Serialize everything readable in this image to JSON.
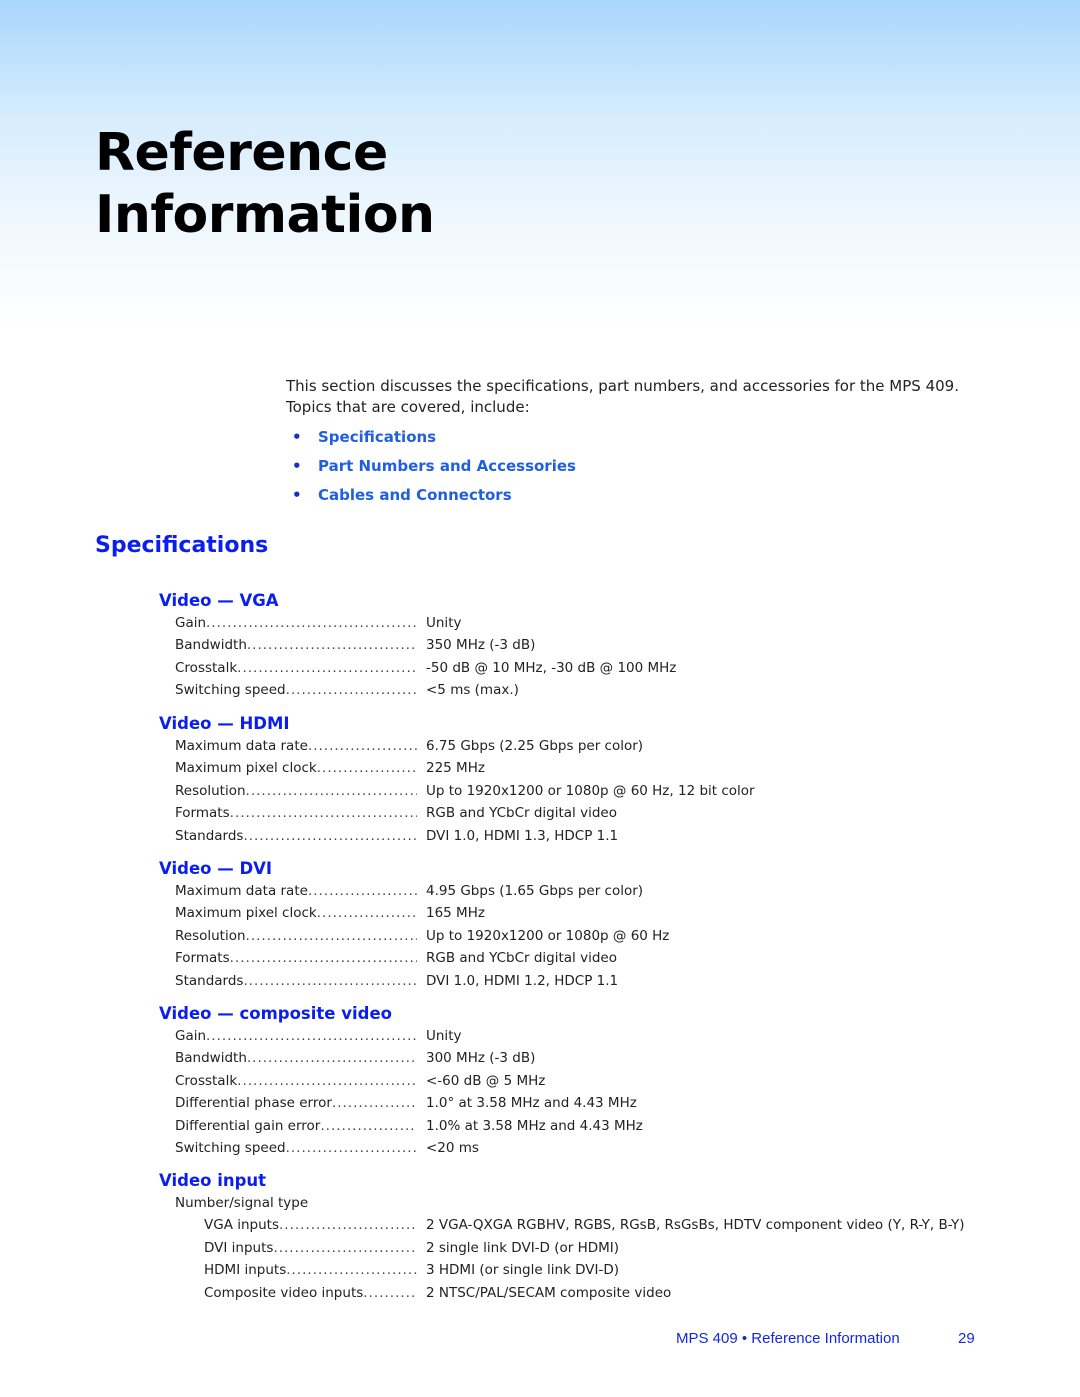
{
  "page_title_line1": "Reference",
  "page_title_line2": "Information",
  "intro": {
    "line1": "This section discusses the specifications, part numbers, and accessories for the MPS 409.",
    "line2": "Topics that are covered, include:"
  },
  "topics": [
    {
      "bullet": "•",
      "label": "Specifications"
    },
    {
      "bullet": "•",
      "label": "Part Numbers and Accessories"
    },
    {
      "bullet": "•",
      "label": "Cables and Connectors"
    }
  ],
  "section_title": "Specifications",
  "blocks": {
    "vga": {
      "title": "Video — VGA",
      "rows": [
        {
          "label": "Gain",
          "value": "Unity"
        },
        {
          "label": "Bandwidth ",
          "value": "350 MHz (-3 dB)"
        },
        {
          "label": "Crosstalk ",
          "value": "-50 dB @ 10 MHz, -30 dB @ 100 MHz"
        },
        {
          "label": "Switching speed",
          "value": "<5 ms (max.)"
        }
      ]
    },
    "hdmi": {
      "title": "Video — HDMI",
      "rows": [
        {
          "label": "Maximum data rate",
          "value": "6.75 Gbps (2.25 Gbps per color)"
        },
        {
          "label": "Maximum pixel clock",
          "value": "225 MHz"
        },
        {
          "label": "Resolution",
          "value": "Up to 1920x1200 or 1080p @ 60 Hz, 12 bit color"
        },
        {
          "label": "Formats",
          "value": "RGB and YCbCr digital video"
        },
        {
          "label": "Standards",
          "value": "DVI 1.0, HDMI 1.3, HDCP 1.1"
        }
      ]
    },
    "dvi": {
      "title": "Video — DVI",
      "rows": [
        {
          "label": "Maximum data rate",
          "value": "4.95 Gbps (1.65 Gbps per color)"
        },
        {
          "label": "Maximum pixel clock",
          "value": "165 MHz"
        },
        {
          "label": "Resolution",
          "value": "Up to 1920x1200 or 1080p @ 60 Hz"
        },
        {
          "label": "Formats",
          "value": "RGB and YCbCr digital video"
        },
        {
          "label": "Standards",
          "value": "DVI 1.0, HDMI 1.2, HDCP 1.1"
        }
      ]
    },
    "composite": {
      "title": "Video — composite video",
      "rows": [
        {
          "label": "Gain",
          "value": "Unity"
        },
        {
          "label": "Bandwidth ",
          "value": "300 MHz (-3 dB)"
        },
        {
          "label": "Crosstalk ",
          "value": "<-60 dB @ 5 MHz"
        },
        {
          "label": "Differential phase error",
          "value": "1.0° at 3.58 MHz and 4.43 MHz"
        },
        {
          "label": "Differential gain error ",
          "value": "1.0% at 3.58 MHz and 4.43 MHz"
        },
        {
          "label": "Switching speed",
          "value": "<20 ms"
        }
      ]
    },
    "input": {
      "title": "Video input",
      "subheading": "Number/signal type",
      "rows": [
        {
          "label": "VGA inputs",
          "value": "2 VGA-QXGA RGBHV, RGBS, RGsB, RsGsBs, HDTV component video (Y, R-Y, B-Y)"
        },
        {
          "label": "DVI inputs",
          "value": "2 single link DVI-D (or HDMI)"
        },
        {
          "label": "HDMI inputs ",
          "value": "3 HDMI (or single link DVI-D)"
        },
        {
          "label": "Composite video inputs ",
          "value": "2 NTSC/PAL/SECAM composite video"
        }
      ]
    }
  },
  "footer": {
    "running_head": "MPS 409 • Reference Information",
    "page_number": "29"
  },
  "colors": {
    "heading_blue": "#0a1ef0",
    "link_blue": "#1f5fe0",
    "banner_top": "#a8d6fc"
  }
}
